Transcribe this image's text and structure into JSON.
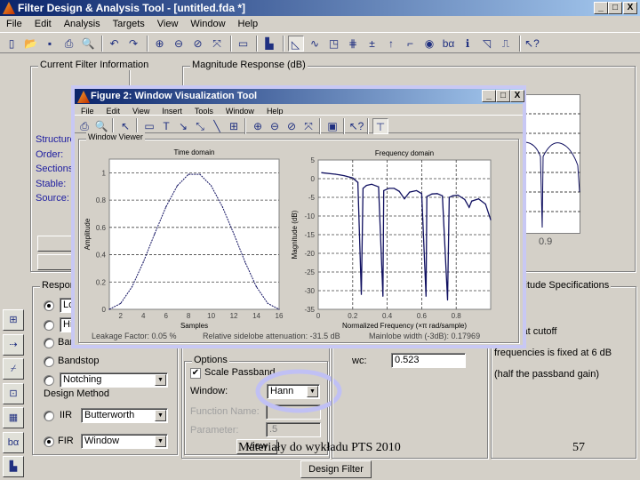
{
  "window": {
    "title": "Filter Design & Analysis Tool - [untitled.fda *]",
    "controls": [
      "_",
      "□",
      "X"
    ]
  },
  "menu": [
    "File",
    "Edit",
    "Analysis",
    "Targets",
    "View",
    "Window",
    "Help"
  ],
  "toolbar": [
    {
      "icon": "new-file-icon",
      "g": "▯"
    },
    {
      "icon": "open-folder-icon",
      "g": "📂"
    },
    {
      "icon": "save-icon",
      "g": "▪"
    },
    {
      "icon": "print-icon",
      "g": "⎙"
    },
    {
      "icon": "print-preview-icon",
      "g": "🔍"
    },
    {
      "sep": true
    },
    {
      "icon": "undo-icon",
      "g": "↶"
    },
    {
      "icon": "redo-icon",
      "g": "↷"
    },
    {
      "sep": true
    },
    {
      "icon": "zoom-in-icon",
      "g": "⊕"
    },
    {
      "icon": "zoom-out-icon",
      "g": "⊖"
    },
    {
      "icon": "zoom-icon",
      "g": "⊘"
    },
    {
      "icon": "fit-icon",
      "g": "⤧"
    },
    {
      "sep": true
    },
    {
      "icon": "new-figure-icon",
      "g": "▭"
    },
    {
      "sep": true
    },
    {
      "icon": "full-view-icon",
      "g": "▙"
    },
    {
      "sep": true
    },
    {
      "icon": "magnitude-response-icon",
      "g": "◺",
      "pressed": true
    },
    {
      "icon": "phase-response-icon",
      "g": "∿"
    },
    {
      "icon": "magnitude-phase-icon",
      "g": "◳"
    },
    {
      "icon": "group-delay-icon",
      "g": "⋕"
    },
    {
      "icon": "phase-delay-icon",
      "g": "±"
    },
    {
      "icon": "impulse-response-icon",
      "g": "↑"
    },
    {
      "icon": "step-response-icon",
      "g": "⌐"
    },
    {
      "icon": "pole-zero-icon",
      "g": "◉"
    },
    {
      "icon": "coefficients-icon",
      "g": "bα"
    },
    {
      "icon": "info-icon",
      "g": "ℹ"
    },
    {
      "icon": "magnitude-estimate-icon",
      "g": "◹"
    },
    {
      "icon": "round-off-noise-icon",
      "g": "⎍"
    },
    {
      "sep": true
    },
    {
      "icon": "whats-this-help-icon",
      "g": "↖?"
    }
  ],
  "current_info": {
    "legend": "Current Filter Information",
    "labels": [
      "Structure:",
      "Order:",
      "Sections:",
      "Stable:",
      "Source:"
    ]
  },
  "magnitude_panel": {
    "legend": "Magnitude Response (dB)",
    "tick": "0.9"
  },
  "sidebar_tools": [
    "transform-filter-icon",
    "import-filter-icon",
    "quantize-icon",
    "realize-model-icon",
    "pole-zero-editor-icon",
    "multirate-icon",
    "design-filter-icon"
  ],
  "response_type": {
    "legend": "Response Type",
    "items": [
      "Lowpass",
      "Highpass",
      "Bandpass",
      "Bandstop"
    ],
    "notching": "Notching",
    "design_method": "Design Method",
    "iir": "IIR",
    "iir_value": "Butterworth",
    "fir": "FIR",
    "fir_value": "Window",
    "selected_response": "Lowpass",
    "selected_method": "FIR"
  },
  "options": {
    "legend": "Options",
    "scale_passband": "Scale Passband",
    "scale_checked": true,
    "window_label": "Window:",
    "window_value": "Hann",
    "function_name_label": "Function Name:",
    "parameter_label": "Parameter:",
    "parameter_value": ".5",
    "view_button": "View"
  },
  "frequency": {
    "wc_label": "wc:",
    "wc_value": "0.523"
  },
  "mag_spec": {
    "legend": "Magnitude Specifications",
    "lines": [
      "The attenuation at cutoff",
      "frequencies is fixed at 6 dB",
      "(half the passband gain)"
    ]
  },
  "design_button": "Design Filter",
  "figure": {
    "title": "Figure 2: Window Visualization Tool",
    "controls": [
      "_",
      "□",
      "X"
    ],
    "menu": [
      "File",
      "Edit",
      "View",
      "Insert",
      "Tools",
      "Window",
      "Help"
    ],
    "toolbar": [
      {
        "icon": "print-icon",
        "g": "⎙"
      },
      {
        "icon": "print-preview-icon",
        "g": "🔍"
      },
      {
        "sep": true
      },
      {
        "icon": "select-arrow-icon",
        "g": "↖"
      },
      {
        "sep": true
      },
      {
        "icon": "rectangle-icon",
        "g": "▭"
      },
      {
        "icon": "text-icon",
        "g": "T"
      },
      {
        "icon": "arrow-icon",
        "g": "↘"
      },
      {
        "icon": "double-arrow-icon",
        "g": "⤡"
      },
      {
        "icon": "line-icon",
        "g": "╲"
      },
      {
        "icon": "legend-icon",
        "g": "⊞"
      },
      {
        "sep": true
      },
      {
        "icon": "zoom-in-icon",
        "g": "⊕"
      },
      {
        "icon": "zoom-out-icon",
        "g": "⊖"
      },
      {
        "icon": "pan-icon",
        "g": "⊘"
      },
      {
        "icon": "fit-icon",
        "g": "⤧"
      },
      {
        "sep": true
      },
      {
        "icon": "export-icon",
        "g": "▣"
      },
      {
        "sep": true
      },
      {
        "icon": "whats-this-help-icon",
        "g": "↖?"
      },
      {
        "sep": true
      },
      {
        "icon": "window-designer-icon",
        "g": "⊤",
        "pressed": true
      }
    ],
    "group": "Window Viewer",
    "leakage": "Leakage Factor: 0.05 %",
    "sidelobe": "Relative sidelobe attenuation: -31.5 dB",
    "mainlobe": "Mainlobe width (-3dB): 0.17969"
  },
  "chart_data": [
    {
      "type": "line",
      "title": "Time domain",
      "xlabel": "Samples",
      "ylabel": "Amplitude",
      "xlim": [
        1,
        16
      ],
      "ylim": [
        0,
        1.1
      ],
      "xticks": [
        2,
        4,
        6,
        8,
        10,
        12,
        14,
        16
      ],
      "yticks": [
        0,
        0.2,
        0.4,
        0.6,
        0.8,
        1
      ],
      "grid": "horizontal-dashed",
      "color": "#101060",
      "x": [
        1,
        2,
        3,
        4,
        5,
        6,
        7,
        8,
        9,
        10,
        11,
        12,
        13,
        14,
        15,
        16
      ],
      "y": [
        0.0,
        0.043,
        0.165,
        0.345,
        0.552,
        0.75,
        0.905,
        0.989,
        0.989,
        0.905,
        0.75,
        0.552,
        0.345,
        0.165,
        0.043,
        0.0
      ]
    },
    {
      "type": "line",
      "title": "Frequency domain",
      "xlabel": "Normalized Frequency (×π rad/sample)",
      "ylabel": "Magnitude (dB)",
      "xlim": [
        0,
        1
      ],
      "ylim": [
        -35,
        5
      ],
      "xticks": [
        0,
        0.2,
        0.4,
        0.6,
        0.8
      ],
      "yticks": [
        5,
        0,
        -5,
        -10,
        -15,
        -20,
        -25,
        -30,
        -35
      ],
      "grid": "dashed",
      "color": "#101060",
      "x": [
        0.02,
        0.1,
        0.15,
        0.2,
        0.23,
        0.25,
        0.26,
        0.28,
        0.31,
        0.35,
        0.375,
        0.38,
        0.41,
        0.44,
        0.47,
        0.5,
        0.53,
        0.57,
        0.6,
        0.625,
        0.63,
        0.66,
        0.69,
        0.72,
        0.75,
        0.76,
        0.78,
        0.81,
        0.85,
        0.875,
        0.89,
        0.93,
        0.97,
        1.0
      ],
      "y": [
        1.6,
        1.2,
        0.8,
        0.2,
        -1.0,
        -31.0,
        -2.6,
        -1.8,
        -1.5,
        -2.2,
        -31.5,
        -3.2,
        -2.6,
        -2.6,
        -3.4,
        -5.4,
        -3.6,
        -3.2,
        -4.0,
        -31.5,
        -4.8,
        -4.1,
        -4.0,
        -4.6,
        -32.5,
        -5.0,
        -4.6,
        -4.4,
        -5.6,
        -7.7,
        -6.0,
        -5.4,
        -6.8,
        -11
      ]
    }
  ],
  "footer": {
    "text": "Materiały do wykładu PTS 2010",
    "page": "57"
  }
}
